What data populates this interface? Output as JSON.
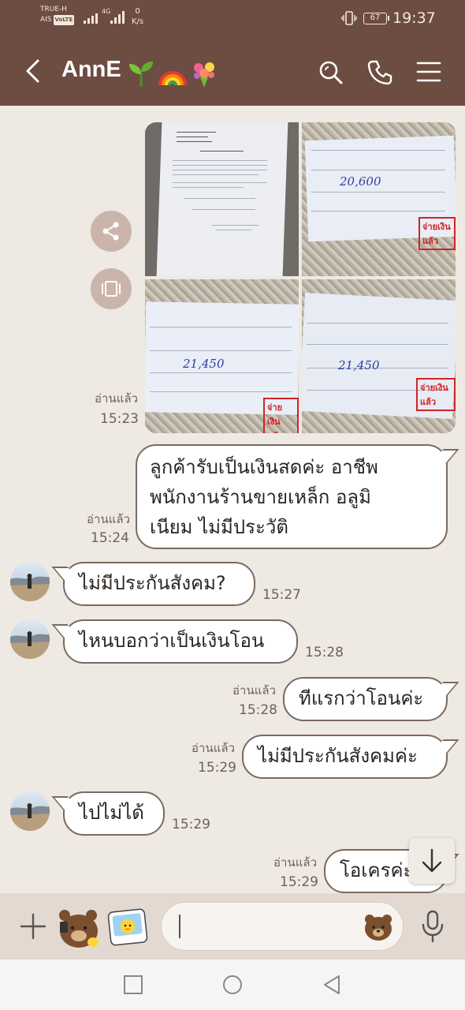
{
  "status_bar": {
    "carrier_top": "TRUE-H",
    "carrier_bottom": "AIS",
    "volte": "VoLTE",
    "network": "4G",
    "speed_value": "0",
    "speed_unit": "K/s",
    "battery": "67",
    "time": "19:37"
  },
  "header": {
    "contact_name": "AnnE",
    "emojis": [
      "seedling",
      "rainbow",
      "bouquet"
    ]
  },
  "messages": [
    {
      "type": "photo-grid",
      "side": "mine",
      "read": "อ่านแล้ว",
      "time": "15:23",
      "photo_count": 4
    },
    {
      "type": "text",
      "side": "mine",
      "read": "อ่านแล้ว",
      "time": "15:24",
      "lines": [
        "ลูกค้ารับเป็นเงินสดค่ะ อาชีพ",
        "พนักงานร้านขายเหล็ก อลูมิ",
        "เนียม ไม่มีประวัติ"
      ]
    },
    {
      "type": "text",
      "side": "theirs",
      "time": "15:27",
      "text": "ไม่มีประกันสังคม?"
    },
    {
      "type": "text",
      "side": "theirs",
      "time": "15:28",
      "text": "ไหนบอกว่าเป็นเงินโอน"
    },
    {
      "type": "text",
      "side": "mine",
      "read": "อ่านแล้ว",
      "time": "15:28",
      "text": "ทีแรกว่าโอนค่ะ"
    },
    {
      "type": "text",
      "side": "mine",
      "read": "อ่านแล้ว",
      "time": "15:29",
      "text": "ไม่มีประกันสังคมค่ะ"
    },
    {
      "type": "text",
      "side": "theirs",
      "time": "15:29",
      "text": "ไปไม่ได้"
    },
    {
      "type": "text",
      "side": "mine",
      "read": "อ่านแล้ว",
      "time": "15:29",
      "text": "โอเครค่ะ"
    }
  ],
  "receipt_ink": {
    "amount_1": "20,600",
    "amount_2": "21,450",
    "amount_3": "21,450",
    "stamp": "จ่ายเงินแล้ว"
  },
  "input_bar": {
    "placeholder": ""
  },
  "colors": {
    "header_bg": "#6d4c41",
    "chat_bg": "#efe9e3",
    "bubble_border": "#7a6a5e",
    "input_bar_bg": "#e3d9d1"
  }
}
